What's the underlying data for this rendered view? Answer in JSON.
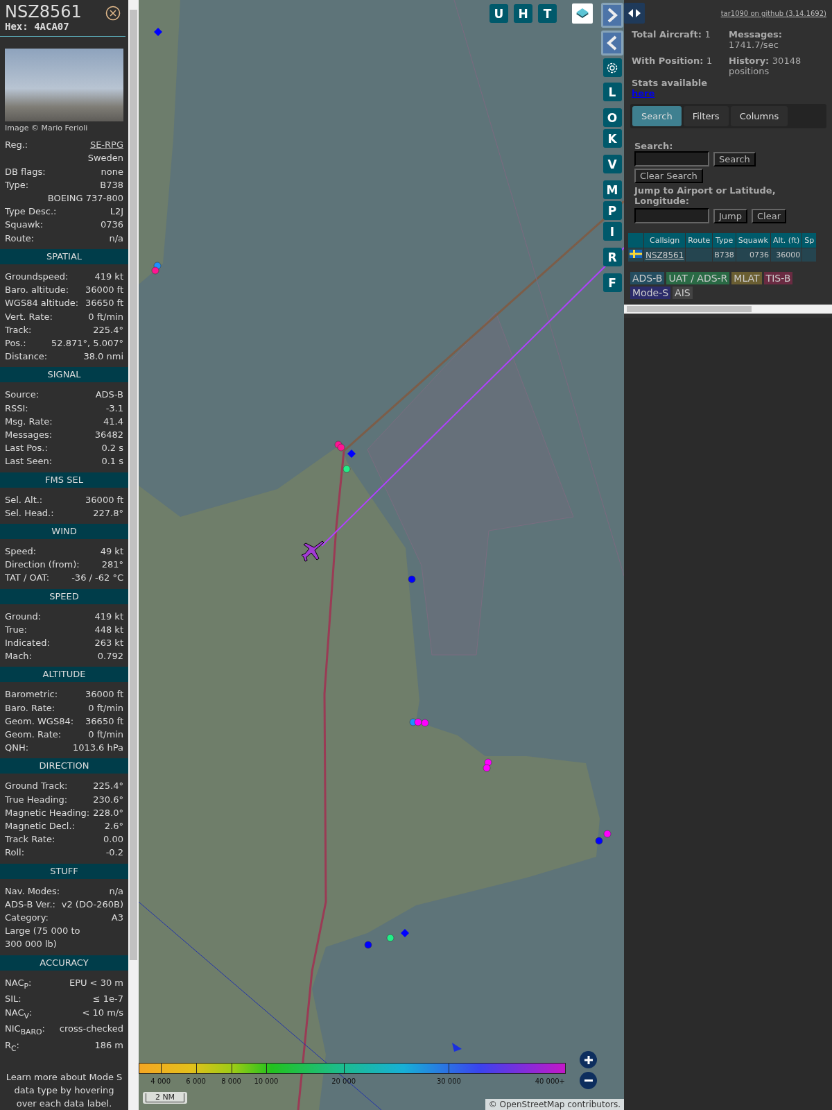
{
  "detail": {
    "callsign": "NSZ8561",
    "hex_label": "Hex:",
    "hex": "4ACA07",
    "photo_credit": "Image © Mario Ferioli",
    "info_rows": [
      {
        "kind": "link",
        "label": "Reg.:",
        "value": "SE-RPG"
      },
      {
        "kind": "value",
        "label": "",
        "value": "Sweden"
      },
      {
        "kind": "pair",
        "label": "DB flags:",
        "value": "none"
      },
      {
        "kind": "pair",
        "label": "Type:",
        "value": "B738"
      },
      {
        "kind": "value",
        "label": "",
        "value": "BOEING 737-800"
      },
      {
        "kind": "pair",
        "label": "Type Desc.:",
        "value": "L2J"
      },
      {
        "kind": "pair",
        "label": "Squawk:",
        "value": "0736"
      },
      {
        "kind": "pair",
        "label": "Route:",
        "value": "n/a"
      }
    ],
    "sections": [
      {
        "title": "SPATIAL",
        "rows": [
          {
            "kind": "pair",
            "label": "Groundspeed:",
            "value": "419 kt"
          },
          {
            "kind": "pair",
            "label": "Baro. altitude:",
            "value": "36000 ft"
          },
          {
            "kind": "pair",
            "label": "WGS84 altitude:",
            "value": "36650 ft"
          },
          {
            "kind": "pair",
            "label": "Vert. Rate:",
            "value": "0 ft/min"
          },
          {
            "kind": "pair",
            "label": "Track:",
            "value": "225.4°"
          },
          {
            "kind": "pair",
            "label": "Pos.:",
            "value": "52.871°, 5.007°"
          },
          {
            "kind": "pair",
            "label": "Distance:",
            "value": "38.0 nmi"
          }
        ]
      },
      {
        "title": "SIGNAL",
        "rows": [
          {
            "kind": "pair",
            "label": "Source:",
            "value": "ADS-B"
          },
          {
            "kind": "pair",
            "label": "RSSI:",
            "value": "-3.1"
          },
          {
            "kind": "pair",
            "label": "Msg. Rate:",
            "value": "41.4"
          },
          {
            "kind": "pair",
            "label": "Messages:",
            "value": "36482"
          },
          {
            "kind": "pair",
            "label": "Last Pos.:",
            "value": "0.2 s"
          },
          {
            "kind": "pair",
            "label": "Last Seen:",
            "value": "0.1 s"
          }
        ]
      },
      {
        "title": "FMS SEL",
        "rows": [
          {
            "kind": "pair",
            "label": "Sel. Alt.:",
            "value": "36000 ft"
          },
          {
            "kind": "pair",
            "label": "Sel. Head.:",
            "value": "227.8°"
          }
        ]
      },
      {
        "title": "WIND",
        "rows": [
          {
            "kind": "pair",
            "label": "Speed:",
            "value": "49 kt"
          },
          {
            "kind": "pair",
            "label": "Direction (from):",
            "value": "281°"
          },
          {
            "kind": "pair",
            "label": "TAT / OAT:",
            "value": "-36 / -62 °C"
          }
        ]
      },
      {
        "title": "SPEED",
        "rows": [
          {
            "kind": "pair",
            "label": "Ground:",
            "value": "419 kt"
          },
          {
            "kind": "pair",
            "label": "True:",
            "value": "448 kt"
          },
          {
            "kind": "pair",
            "label": "Indicated:",
            "value": "263 kt"
          },
          {
            "kind": "pair",
            "label": "Mach:",
            "value": "0.792"
          }
        ]
      },
      {
        "title": "ALTITUDE",
        "rows": [
          {
            "kind": "pair",
            "label": "Barometric:",
            "value": "36000 ft"
          },
          {
            "kind": "pair",
            "label": "Baro. Rate:",
            "value": "0 ft/min"
          },
          {
            "kind": "pair",
            "label": "Geom. WGS84:",
            "value": "36650 ft"
          },
          {
            "kind": "pair",
            "label": "Geom. Rate:",
            "value": "0 ft/min"
          },
          {
            "kind": "pair",
            "label": "QNH:",
            "value": "1013.6 hPa"
          }
        ]
      },
      {
        "title": "DIRECTION",
        "rows": [
          {
            "kind": "pair",
            "label": "Ground Track:",
            "value": "225.4°"
          },
          {
            "kind": "pair",
            "label": "True Heading:",
            "value": "230.6°"
          },
          {
            "kind": "pair",
            "label": "Magnetic Heading:",
            "value": "228.0°"
          },
          {
            "kind": "pair",
            "label": "Magnetic Decl.:",
            "value": "2.6°"
          },
          {
            "kind": "pair",
            "label": "Track Rate:",
            "value": "0.00"
          },
          {
            "kind": "pair",
            "label": "Roll:",
            "value": "-0.2"
          }
        ]
      },
      {
        "title": "STUFF",
        "rows": [
          {
            "kind": "pair",
            "label": "Nav. Modes:",
            "value": "n/a"
          },
          {
            "kind": "pair",
            "label": "ADS-B Ver.:",
            "value": "v2 (DO-260B)"
          },
          {
            "kind": "pair",
            "label": "Category:",
            "value": "A3"
          },
          {
            "kind": "text",
            "label": "Large (75 000 to 300 000 lb)",
            "value": ""
          }
        ]
      },
      {
        "title": "ACCURACY",
        "rows": [
          {
            "kind": "pair",
            "label": "NAC$_{P}$:",
            "value": "EPU < 30 m"
          },
          {
            "kind": "pair",
            "label": "SIL:",
            "value": "≤ 1e-7"
          },
          {
            "kind": "pair",
            "label": "NAC$_{V}$:",
            "value": "< 10 m/s"
          },
          {
            "kind": "pair",
            "label": "NIC$_{BARO}$:",
            "value": "cross-checked"
          },
          {
            "kind": "pair",
            "label": "R$_{C}$:",
            "value": "186 m"
          }
        ]
      }
    ],
    "footer": "Learn more about Mode S data type by hovering over each data label."
  },
  "map": {
    "top_buttons": [
      "U",
      "H",
      "T"
    ],
    "side_buttons": [
      {
        "kind": "next"
      },
      {
        "kind": "prev"
      },
      {
        "kind": "settings"
      },
      {
        "kind": "letter",
        "label": "L"
      },
      {
        "kind": "letter",
        "label": "O"
      },
      {
        "kind": "letter",
        "label": "K"
      },
      {
        "kind": "letter",
        "label": "V"
      },
      {
        "kind": "letter",
        "label": "M"
      },
      {
        "kind": "letter",
        "label": "P"
      },
      {
        "kind": "letter",
        "label": "I"
      },
      {
        "kind": "letter",
        "label": "R"
      },
      {
        "kind": "letter",
        "label": "F"
      }
    ],
    "altitude_legend": [
      "4 000",
      "6 000",
      "8 000",
      "10 000",
      "20 000",
      "30 000",
      "40 000+"
    ],
    "scale": "2 NM",
    "attribution_prefix": "©",
    "attribution_link": "OpenStreetMap",
    "attribution_suffix": "contributors."
  },
  "panel": {
    "version_link": "tar1090 on github (3.14.1692)",
    "stats": [
      {
        "label": "Total Aircraft:",
        "value": "1"
      },
      {
        "label": "Messages:",
        "value": "1741.7/sec"
      },
      {
        "label": "With Position:",
        "value": "1"
      },
      {
        "label": "History:",
        "value": "30148 positions"
      }
    ],
    "stats_note": "Stats available",
    "stats_link": "here",
    "tabs": [
      {
        "label": "Search",
        "selected": true
      },
      {
        "label": "Filters",
        "selected": false
      },
      {
        "label": "Columns",
        "selected": false
      }
    ],
    "search_label": "Search:",
    "search_button": "Search",
    "clear_search_button": "Clear Search",
    "jump_label": "Jump to Airport or Latitude, Longitude:",
    "jump_button": "Jump",
    "clear_button": "Clear",
    "table": {
      "columns": [
        "",
        "Callsign",
        "Route",
        "Type",
        "Squawk",
        "Alt. (ft)",
        "Sp"
      ],
      "rows": [
        {
          "callsign": "NSZ8561",
          "route": "",
          "type": "B738",
          "squawk": "0736",
          "altitude": "36000",
          "speed": ""
        }
      ]
    },
    "source_tags": [
      {
        "label": "ADS-B",
        "color": "#244d60"
      },
      {
        "label": "UAT / ADS-R",
        "color": "#2a6a45"
      },
      {
        "label": "MLAT",
        "color": "#6a5e32"
      },
      {
        "label": "TIS-B",
        "color": "#6a2b42"
      },
      {
        "label": "Mode-S",
        "color": "#2c2c6a"
      },
      {
        "label": "AIS",
        "color": "#444444"
      }
    ]
  }
}
